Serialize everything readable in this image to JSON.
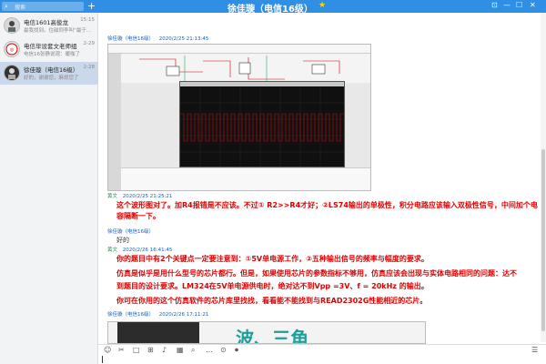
{
  "topbar": {
    "search_placeholder": "搜索",
    "plus_label": "+",
    "title": "徐佳璇（电信16级）",
    "star_icon": "star-icon",
    "controls": [
      "⊡",
      "—",
      "☐",
      "✕"
    ]
  },
  "sidebar": {
    "items": [
      {
        "name": "电信1601高俊龙",
        "msg": "最我找到。住磁同李叫“最于…",
        "time": "15:15"
      },
      {
        "name": "电信毕设套文老师组",
        "msg": "电信16张静说观：暖咖了",
        "time": "2-29"
      },
      {
        "name": "徐佳璇（电信16级）",
        "msg": "好的，谢谢您，麻烦您了",
        "time": "2-28"
      }
    ]
  },
  "chat": {
    "m1_sender": "徐佳璇（电信16级）",
    "m1_time": "2020/2/25 21:13:45",
    "m2_sender": "黄文",
    "m2_time": "2020/2/25 21:25:21",
    "m2_text": "这个波形图对了。加R4报错是不应该。不过① R2>>R4才好；②LS74输出的单极性，积分电路应该输入双极性信号，中间加个电容隔断一下。",
    "m3_sender": "徐佳璇（电信16级）",
    "m3_text": "好的",
    "m4_sender": "黄文",
    "m4_time": "2020/2/26 16:41:45",
    "m4_line1": "你的题目中有2个关键点一定要注意到：①5V单电源工作，②五种输出信号的频率与幅度的要求。",
    "m4_line2": "仿真是似乎是用什么型号的芯片都行。但是，如果使用芯片的参数指标不够用，仿真应该会出现与实体电路相同的问题：达不",
    "m4_line3": "到题目的设计要求。LM324在5V单电源供电时，绝对达不到Vpp =3V、f = 20kHz 的输出。",
    "m4_line4": "你可在你用的这个仿真软件的芯片库里找找，看看能不能找到与READ2302G性能相近的芯片。",
    "m5_sender": "徐佳璇（电信16级）",
    "m5_time": "2020/2/26 17:11:21",
    "shot2_text": "波、三角"
  },
  "toolbar": {
    "icons": [
      "☺",
      "✂",
      "□",
      "⊞",
      "♪",
      "▦",
      "⌕",
      "…",
      "⊙",
      "⏺",
      "☰"
    ]
  },
  "colors": {
    "accent": "#2f8fe4",
    "message_red": "#e00000",
    "sender_blue": "#1a5fb4"
  }
}
